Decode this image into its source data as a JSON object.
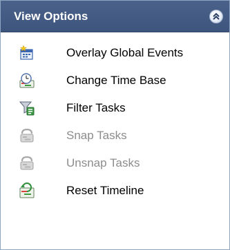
{
  "panel": {
    "title": "View Options",
    "header_color": "#435a82",
    "collapse_icon": "double-chevron-up-icon"
  },
  "items": [
    {
      "label": "Overlay Global Events",
      "icon": "calendar-star-icon",
      "enabled": true
    },
    {
      "label": "Change Time Base",
      "icon": "clock-timeline-icon",
      "enabled": true
    },
    {
      "label": "Filter Tasks",
      "icon": "funnel-filter-icon",
      "enabled": true
    },
    {
      "label": "Snap Tasks",
      "icon": "snap-tasks-icon",
      "enabled": false
    },
    {
      "label": "Unsnap Tasks",
      "icon": "unsnap-tasks-icon",
      "enabled": false
    },
    {
      "label": "Reset Timeline",
      "icon": "reset-timeline-icon",
      "enabled": true
    }
  ]
}
